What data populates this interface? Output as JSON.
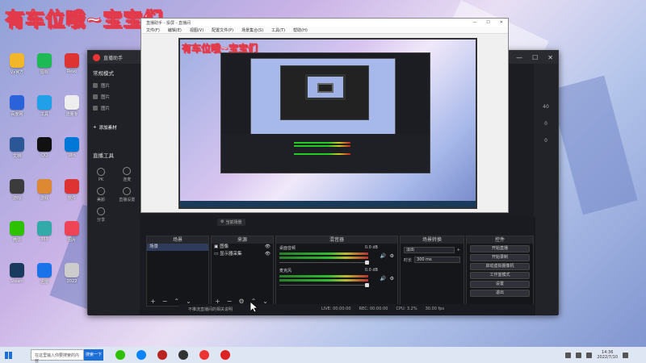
{
  "overlay": {
    "caption": "有车位哦~宝宝们"
  },
  "desktop": {
    "icons": [
      {
        "label": "Vx官方",
        "color": "#f2b62a"
      },
      {
        "label": "图标",
        "color": "#1db954"
      },
      {
        "label": "Revo",
        "color": "#d33"
      },
      {
        "label": "百度网",
        "color": "#2a62d9"
      },
      {
        "label": "工具",
        "color": "#1fa0e8"
      },
      {
        "label": "流量专",
        "color": "#eee"
      },
      {
        "label": "文档",
        "color": "#2b5797"
      },
      {
        "label": "QQ",
        "color": "#111"
      },
      {
        "label": "Win",
        "color": "#0078d7"
      },
      {
        "label": "游戏",
        "color": "#3b3b3b"
      },
      {
        "label": "游戏",
        "color": "#d83"
      },
      {
        "label": "软件",
        "color": "#d33"
      },
      {
        "label": "微信",
        "color": "#2dc100"
      },
      {
        "label": "360",
        "color": "#3aa"
      },
      {
        "label": "图片",
        "color": "#e45"
      },
      {
        "label": "Steam",
        "color": "#173a5e"
      },
      {
        "label": "迅雷",
        "color": "#1a73e8"
      },
      {
        "label": "2022",
        "color": "#ccc"
      }
    ]
  },
  "obs": {
    "window_title": "直播助手",
    "mode_label": "常规模式",
    "scene_items": [
      "图片",
      "图片",
      "图片"
    ],
    "add_source": "添加素材",
    "live_tools": "直播工具",
    "tools": [
      "PK",
      "连麦",
      "美颜",
      "直播设置",
      "分享"
    ],
    "right_numbers": [
      "40",
      "0",
      "0"
    ],
    "dock_tabs": [
      "当前场景"
    ],
    "panel_titles": {
      "scenes": "场景",
      "sources": "来源",
      "mixer": "混音器",
      "transitions": "场景转换",
      "controls": "控件"
    },
    "scenes_rows": [
      "场景"
    ],
    "sources_rows": [
      "图像",
      "显示器采集"
    ],
    "mixer_tracks": [
      {
        "name": "桌面音频",
        "db": "0.0 dB"
      },
      {
        "name": "麦克风",
        "db": "0.0 dB"
      }
    ],
    "transition": {
      "type_label": "淡出",
      "duration_label": "时长",
      "duration_value": "300 ms"
    },
    "controls": [
      "开始直播",
      "开始录制",
      "启动虚拟摄像机",
      "工作室模式",
      "设置",
      "退出"
    ],
    "status": {
      "notice": "不推流直播间的相关说明",
      "live": "LIVE: 00:00:00",
      "rec": "REC: 00:00:00",
      "cpu": "CPU: 3.2%",
      "fps": "30.00 fps"
    }
  },
  "capture_window": {
    "title": "直播助手 - 投屏 - 直播间",
    "menu": [
      "文件(F)",
      "编辑(E)",
      "视图(V)",
      "配置文件(P)",
      "场景集合(S)",
      "工具(T)",
      "帮助(H)"
    ]
  },
  "taskbar": {
    "search_text": "在这里输入你要搜索的内容",
    "search_button": "搜索一下",
    "time": "14:36",
    "date": "2022/7/10"
  }
}
